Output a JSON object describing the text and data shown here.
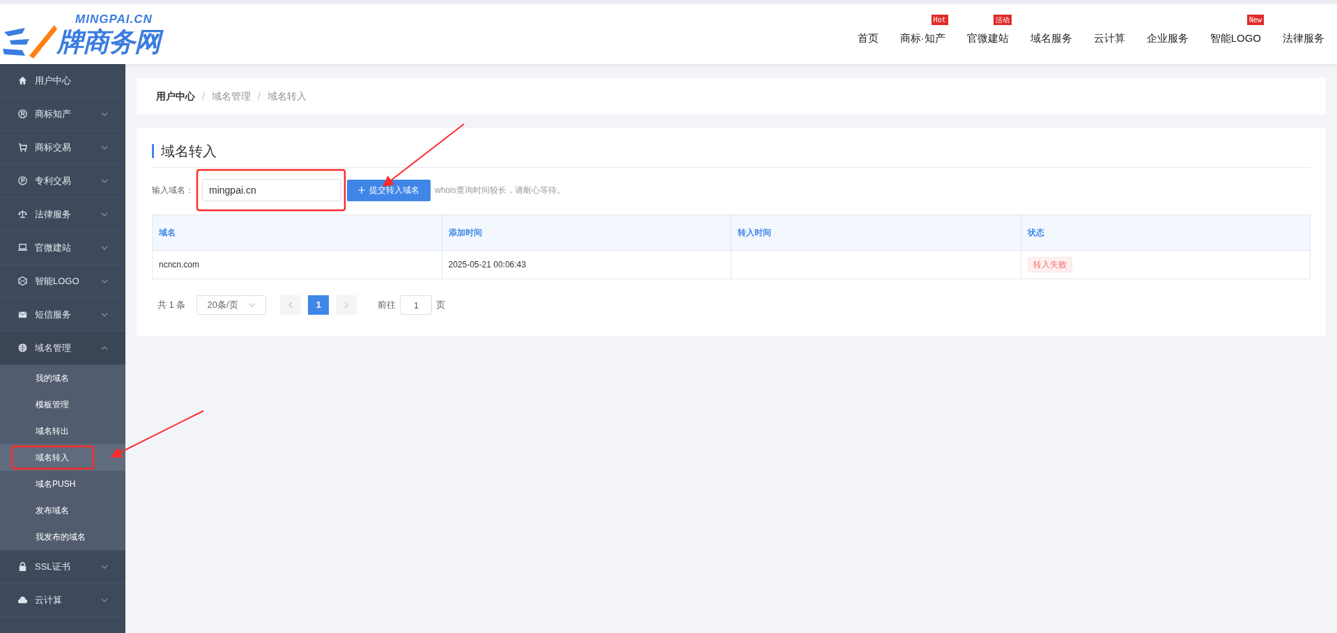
{
  "logo": {
    "text": "牌商务网",
    "tagline": "MINGPAI.CN"
  },
  "nav": [
    {
      "label": "首页"
    },
    {
      "label": "商标·知产",
      "badge": "Hot"
    },
    {
      "label": "官微建站",
      "badge": "活动"
    },
    {
      "label": "域名服务"
    },
    {
      "label": "云计算"
    },
    {
      "label": "企业服务"
    },
    {
      "label": "智能LOGO",
      "badge": "New"
    },
    {
      "label": "法律服务"
    }
  ],
  "sidebar": {
    "items": [
      {
        "label": "用户中心",
        "kind": "link"
      },
      {
        "label": "商标知产",
        "kind": "group",
        "expanded": false
      },
      {
        "label": "商标交易",
        "kind": "group",
        "expanded": false
      },
      {
        "label": "专利交易",
        "kind": "group",
        "expanded": false
      },
      {
        "label": "法律服务",
        "kind": "group",
        "expanded": false
      },
      {
        "label": "官微建站",
        "kind": "group",
        "expanded": false
      },
      {
        "label": "智能LOGO",
        "kind": "group",
        "expanded": false
      },
      {
        "label": "短信服务",
        "kind": "group",
        "expanded": false
      },
      {
        "label": "域名管理",
        "kind": "group",
        "expanded": true,
        "children": [
          {
            "label": "我的域名",
            "selected": false
          },
          {
            "label": "模板管理",
            "selected": false
          },
          {
            "label": "域名转出",
            "selected": false
          },
          {
            "label": "域名转入",
            "selected": true
          },
          {
            "label": "域名PUSH",
            "selected": false
          },
          {
            "label": "发布域名",
            "selected": false
          },
          {
            "label": "我发布的域名",
            "selected": false
          }
        ]
      },
      {
        "label": "SSL证书",
        "kind": "group",
        "expanded": false
      },
      {
        "label": "云计算",
        "kind": "group",
        "expanded": false
      }
    ]
  },
  "breadcrumb": [
    {
      "label": "用户中心"
    },
    {
      "separator": "/",
      "label": "域名管理"
    },
    {
      "separator": "/",
      "label": "域名转入"
    }
  ],
  "page_title": "域名转入",
  "form": {
    "label": "输入域名：",
    "value": "mingpai.cn",
    "button": "提交转入域名",
    "hint": "whois查询时间较长，请耐心等待。"
  },
  "table": {
    "columns": [
      "域名",
      "添加时间",
      "转入时间",
      "状态"
    ],
    "rows": [
      {
        "cells": [
          "ncncn.com",
          "2025-05-21 00:06:43",
          ""
        ],
        "status": "转入失败"
      }
    ]
  },
  "pagination": {
    "total": "共 1 条",
    "page_size": "20条/页",
    "pages": [
      {
        "label": "1",
        "selected": true
      }
    ],
    "goto_label": "前往",
    "goto_value": "1",
    "goto_suffix": "页"
  }
}
